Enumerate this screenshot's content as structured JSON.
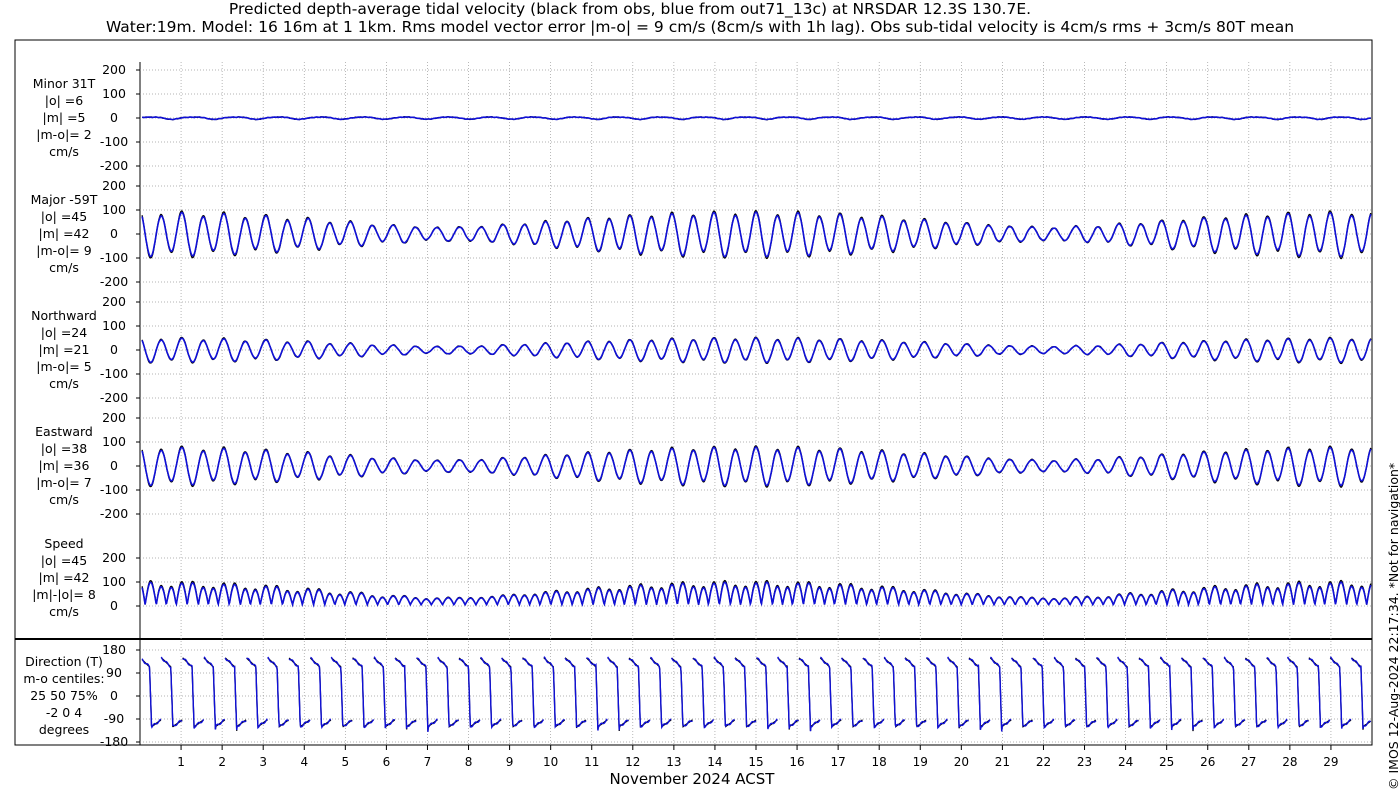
{
  "title": {
    "line1": "Predicted depth-average tidal velocity (black from obs, blue from out71_13c) at NRSDAR 12.3S 130.7E.",
    "line2": "Water:19m. Model: 16 16m at 1 1km. Rms model vector error |m-o| = 9 cm/s (8cm/s with 1h lag). Obs sub-tidal velocity is 4cm/s rms + 3cm/s 80T mean"
  },
  "side_note": "© IMOS 12-Aug-2024 22:17:34. *Not for navigation*",
  "colors": {
    "obs": "#000000",
    "model": "#1010d8",
    "grid": "#9a9a9a",
    "axis": "#000000"
  },
  "chart_data": {
    "type": "line",
    "xlabel": "November 2024 ACST",
    "xticks": [
      "1",
      "2",
      "3",
      "4",
      "5",
      "6",
      "7",
      "8",
      "9",
      "10",
      "11",
      "12",
      "13",
      "14",
      "15",
      "16",
      "17",
      "18",
      "19",
      "20",
      "21",
      "22",
      "23",
      "24",
      "25",
      "26",
      "27",
      "28",
      "29"
    ],
    "xlim": [
      0,
      30
    ],
    "series": [
      {
        "name": "obs"
      },
      {
        "name": "model"
      }
    ],
    "panels": [
      {
        "label": [
          "Minor 31T",
          "|o| =6",
          "|m| =5",
          "|m-o|= 2",
          "cm/s"
        ],
        "yticks": [
          "200",
          "100",
          "0",
          "-100",
          "-200"
        ],
        "ytick_values": [
          200,
          100,
          0,
          -100,
          -200
        ],
        "ylim": [
          -200,
          200
        ],
        "kind": "minor",
        "amplitude": 6
      },
      {
        "label": [
          "Major -59T",
          "|o| =45",
          "|m| =42",
          "|m-o|= 9",
          "cm/s"
        ],
        "yticks": [
          "200",
          "100",
          "0",
          "-100",
          "-200"
        ],
        "ytick_values": [
          200,
          100,
          0,
          -100,
          -200
        ],
        "ylim": [
          -200,
          200
        ],
        "kind": "major",
        "amplitude": 45
      },
      {
        "label": [
          "Northward",
          "|o| =24",
          "|m| =21",
          "|m-o|= 5",
          "cm/s"
        ],
        "yticks": [
          "200",
          "100",
          "0",
          "-100",
          "-200"
        ],
        "ytick_values": [
          200,
          100,
          0,
          -100,
          -200
        ],
        "ylim": [
          -200,
          200
        ],
        "kind": "north",
        "amplitude": 24
      },
      {
        "label": [
          "Eastward",
          "|o| =38",
          "|m| =36",
          "|m-o|= 7",
          "cm/s"
        ],
        "yticks": [
          "200",
          "100",
          "0",
          "-100",
          "-200"
        ],
        "ytick_values": [
          200,
          100,
          0,
          -100,
          -200
        ],
        "ylim": [
          -200,
          200
        ],
        "kind": "east",
        "amplitude": 38
      },
      {
        "label": [
          "Speed",
          "|o| =45",
          "|m| =42",
          "|m|-|o|= 8",
          "cm/s"
        ],
        "yticks": [
          "200",
          "100",
          "0"
        ],
        "ytick_values": [
          200,
          100,
          0
        ],
        "ylim": [
          0,
          200
        ],
        "kind": "speed",
        "amplitude": 45
      },
      {
        "label": [
          "Direction (T)",
          "m-o centiles:",
          "25  50  75%",
          "-2  0  4",
          "degrees"
        ],
        "yticks": [
          "180",
          "90",
          "0",
          "-90",
          "-180"
        ],
        "ytick_values": [
          180,
          90,
          0,
          -90,
          -180
        ],
        "ylim": [
          -180,
          180
        ],
        "kind": "direction"
      }
    ]
  }
}
